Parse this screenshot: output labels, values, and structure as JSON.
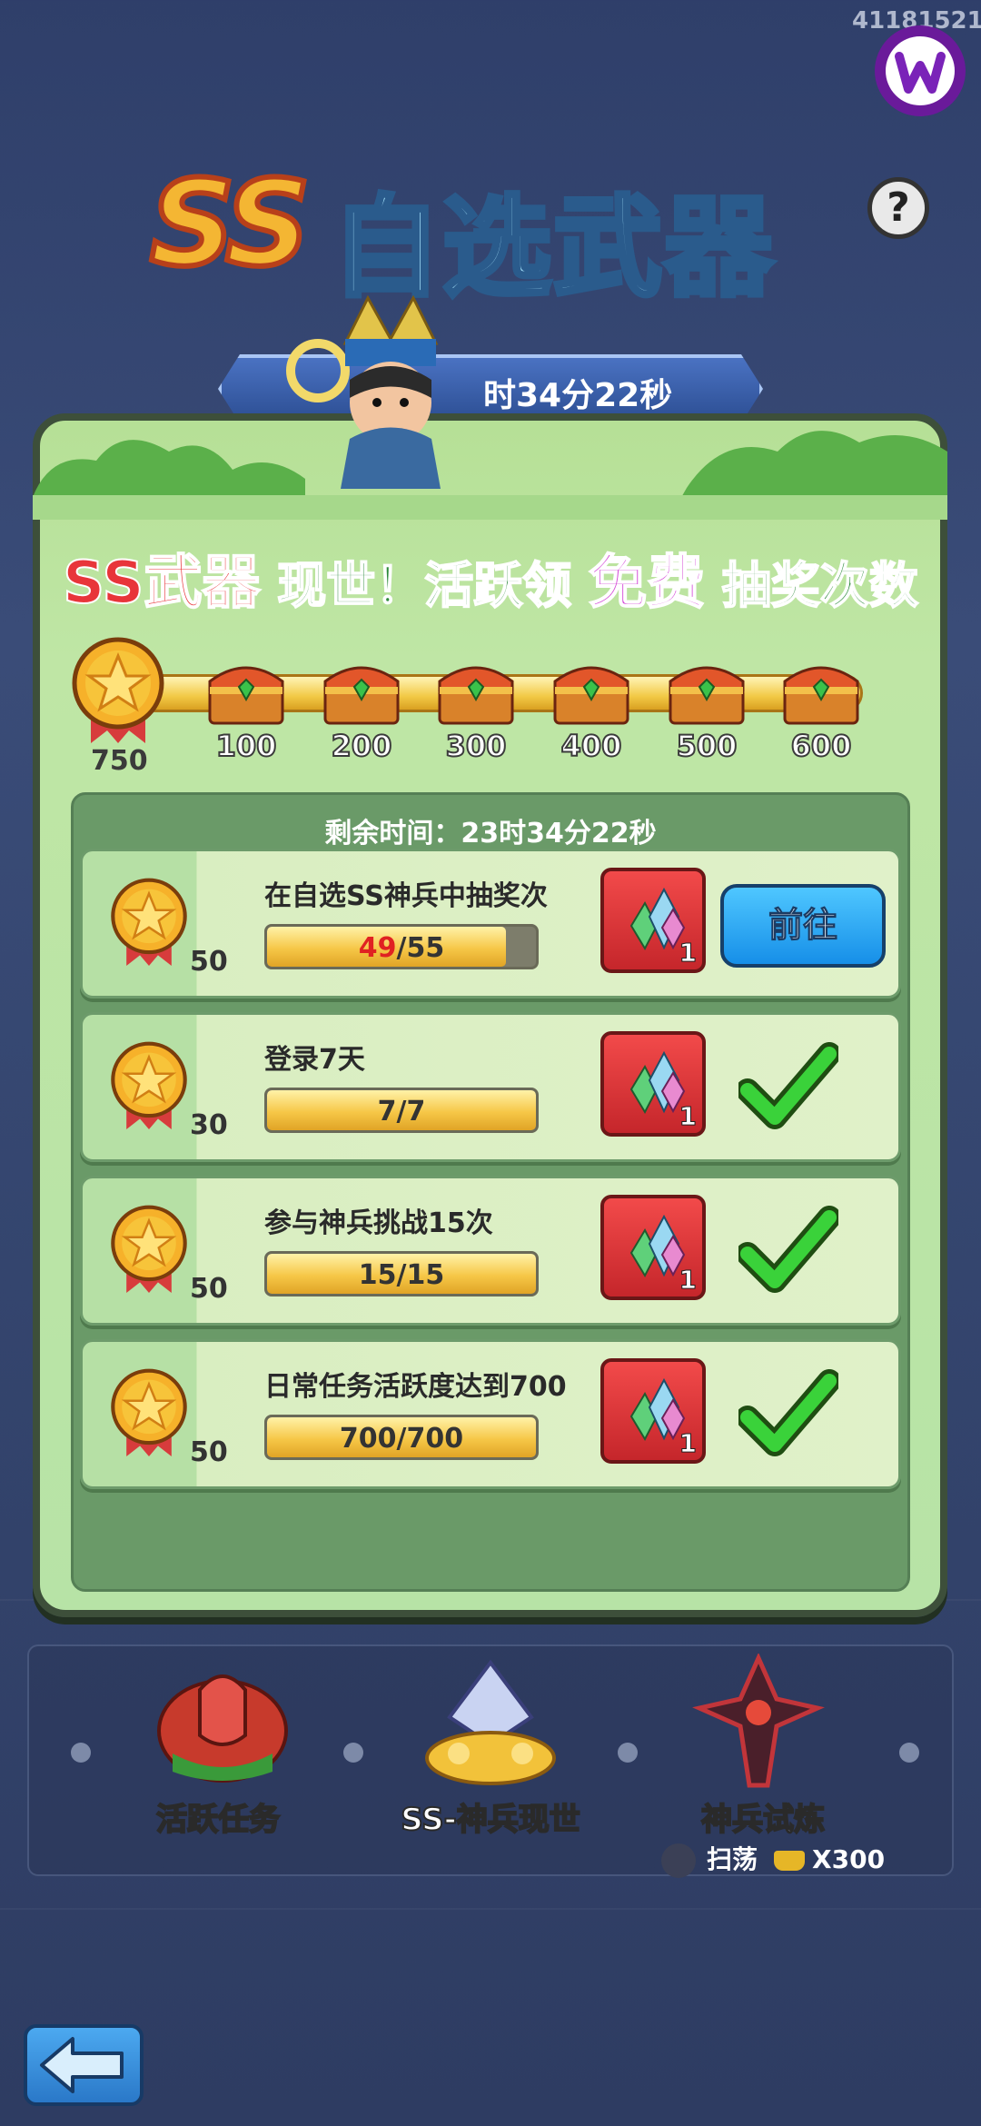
{
  "top_id": "41181521",
  "title": {
    "ss": "SS",
    "main": "自选武器"
  },
  "help": "?",
  "timer_banner": "时34分22秒",
  "headline": {
    "part1": "SS武器",
    "part2": "现世！活跃领",
    "part3": "免费",
    "part4": "抽奖次数"
  },
  "progress": {
    "current": "750",
    "milestones": [
      "100",
      "200",
      "300",
      "400",
      "500",
      "600"
    ]
  },
  "remaining_time": "剩余时间：23时34分22秒",
  "tasks": [
    {
      "points": "50",
      "title": "在自选SS神兵中抽奖次",
      "current": "49",
      "sep": "/55",
      "progress": 0.89,
      "reward_qty": "1",
      "action": "前往"
    },
    {
      "points": "30",
      "title": "登录7天",
      "progress_text": "7/7",
      "progress": 1.0,
      "reward_qty": "1"
    },
    {
      "points": "50",
      "title": "参与神兵挑战15次",
      "progress_text": "15/15",
      "progress": 1.0,
      "reward_qty": "1"
    },
    {
      "points": "50",
      "title": "日常任务活跃度达到700",
      "progress_text": "700/700",
      "progress": 1.0,
      "reward_qty": "1"
    }
  ],
  "bottom_nav": [
    {
      "label": "活跃任务",
      "icon": "rose-shield-icon"
    },
    {
      "label": "SS-神兵现世",
      "icon": "weapon-treasure-icon"
    },
    {
      "label": "神兵试炼",
      "icon": "dark-sword-icon"
    }
  ],
  "sweep": {
    "label": "扫荡",
    "cost": "X300"
  },
  "colors": {
    "accent_blue": "#168fe8",
    "panel_green": "#b7e3a6",
    "reward_red": "#c5262b",
    "gold": "#f6c747"
  }
}
